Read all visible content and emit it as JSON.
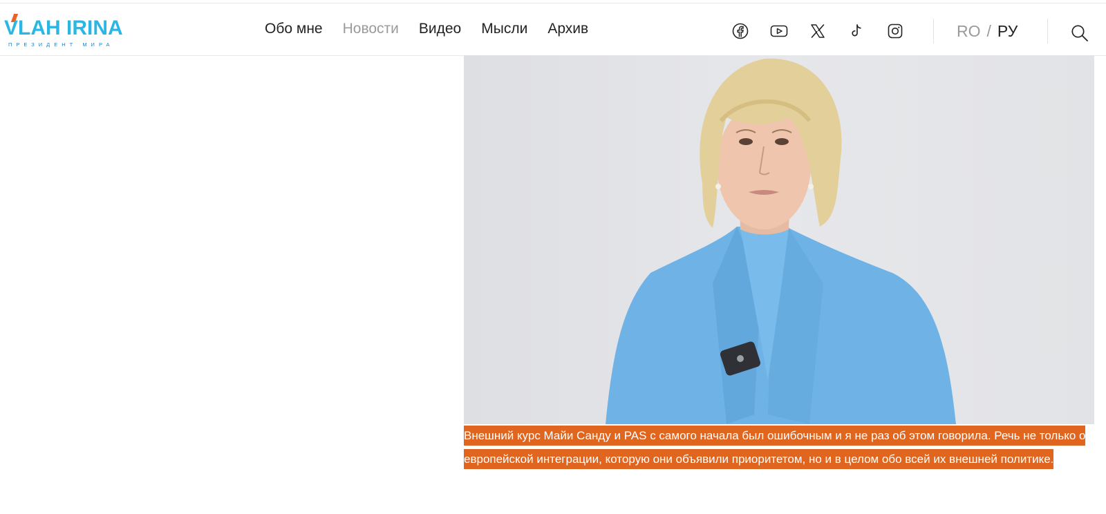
{
  "logo": {
    "main": "VLAH IRINA",
    "sub": "ПРЕЗИДЕНТ МИРА"
  },
  "nav": [
    {
      "label": "Обо мне",
      "active": false
    },
    {
      "label": "Новости",
      "active": true
    },
    {
      "label": "Видео",
      "active": false
    },
    {
      "label": "Мысли",
      "active": false
    },
    {
      "label": "Архив",
      "active": false
    }
  ],
  "social": [
    "facebook-icon",
    "youtube-icon",
    "x-icon",
    "tiktok-icon",
    "instagram-icon"
  ],
  "lang": {
    "ro": "RO",
    "separator": "/",
    "ru": "РУ"
  },
  "caption": "Внешний курс Майи Санду и PAS с самого начала был ошибочным и я не раз об этом говорила. Речь не только о европейской интеграции, которую они объявили приоритетом, но и в целом обо всей их внешней политике.",
  "colors": {
    "logo": "#2bb7e3",
    "accent": "#e0661f",
    "nav_active": "#9a9a9a",
    "jacket": "#6fb3e6"
  }
}
